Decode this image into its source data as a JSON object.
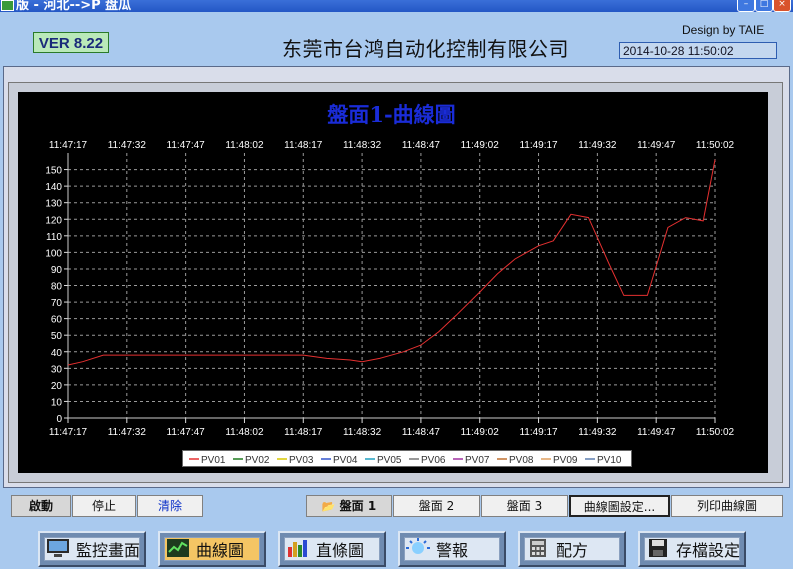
{
  "window": {
    "title": "版 - 河北-->P 盘瓜"
  },
  "header": {
    "version": "VER 8.22",
    "company": "东莞市台鸿自动化控制有限公司",
    "design_by": "Design by TAIE",
    "datetime": "2014-10-28 11:50:02"
  },
  "chart_data": {
    "type": "line",
    "title": "盤面1-曲線圖",
    "x": [
      "11:47:17",
      "11:47:32",
      "11:47:47",
      "11:48:02",
      "11:48:17",
      "11:48:32",
      "11:48:47",
      "11:49:02",
      "11:49:17",
      "11:49:32",
      "11:49:47",
      "11:50:02"
    ],
    "ylim": [
      0,
      160
    ],
    "yticks": [
      0,
      10,
      20,
      30,
      40,
      50,
      60,
      70,
      80,
      90,
      100,
      110,
      120,
      130,
      140,
      150
    ],
    "grid": true,
    "legend_position": "bottom",
    "series": [
      {
        "name": "PV01",
        "color": "#e53030",
        "points": [
          [
            0,
            32
          ],
          [
            0.25,
            34
          ],
          [
            0.6,
            38
          ],
          [
            1,
            38
          ],
          [
            1.5,
            38
          ],
          [
            2,
            38
          ],
          [
            2.5,
            38
          ],
          [
            3,
            38
          ],
          [
            3.5,
            38
          ],
          [
            4,
            38
          ],
          [
            4.4,
            36
          ],
          [
            4.8,
            35
          ],
          [
            5,
            34
          ],
          [
            5.3,
            36
          ],
          [
            5.7,
            40
          ],
          [
            6,
            44
          ],
          [
            6.3,
            52
          ],
          [
            6.6,
            62
          ],
          [
            7,
            76
          ],
          [
            7.3,
            87
          ],
          [
            7.6,
            96
          ],
          [
            8,
            104
          ],
          [
            8.25,
            107
          ],
          [
            8.55,
            123
          ],
          [
            8.85,
            121
          ],
          [
            9.2,
            93
          ],
          [
            9.45,
            74
          ],
          [
            9.85,
            74
          ],
          [
            10.2,
            115
          ],
          [
            10.5,
            121
          ],
          [
            10.8,
            119
          ],
          [
            11,
            156
          ]
        ]
      },
      {
        "name": "PV02",
        "color": "#1f7a1f",
        "points": []
      },
      {
        "name": "PV03",
        "color": "#d8c800",
        "points": []
      },
      {
        "name": "PV04",
        "color": "#3355cc",
        "points": []
      },
      {
        "name": "PV05",
        "color": "#20a0c0",
        "points": []
      },
      {
        "name": "PV06",
        "color": "#777777",
        "points": []
      },
      {
        "name": "PV07",
        "color": "#a030a0",
        "points": []
      },
      {
        "name": "PV08",
        "color": "#c07030",
        "points": []
      },
      {
        "name": "PV09",
        "color": "#e0a060",
        "points": []
      },
      {
        "name": "PV10",
        "color": "#5e7fb0",
        "points": []
      }
    ]
  },
  "tabs": {
    "start": "啟動",
    "stop": "停止",
    "clear": "清除",
    "panel1": "盤面 1",
    "panel2": "盤面 2",
    "panel3": "盤面 3",
    "curve_settings": "曲線圖設定...",
    "print_curve": "列印曲線圖"
  },
  "nav": [
    {
      "label": "監控畫面",
      "icon": "monitor-icon"
    },
    {
      "label": "曲線圖",
      "icon": "line-chart-icon"
    },
    {
      "label": "直條圖",
      "icon": "bar-chart-icon"
    },
    {
      "label": "警報",
      "icon": "alarm-light-icon"
    },
    {
      "label": "配方",
      "icon": "calculator-icon"
    },
    {
      "label": "存檔設定",
      "icon": "save-disk-icon"
    }
  ],
  "colors": {
    "background": "#a9c9ee",
    "active_nav": "#f4c564",
    "title": "#1a2cd8",
    "grid": "#9a9a9a"
  }
}
